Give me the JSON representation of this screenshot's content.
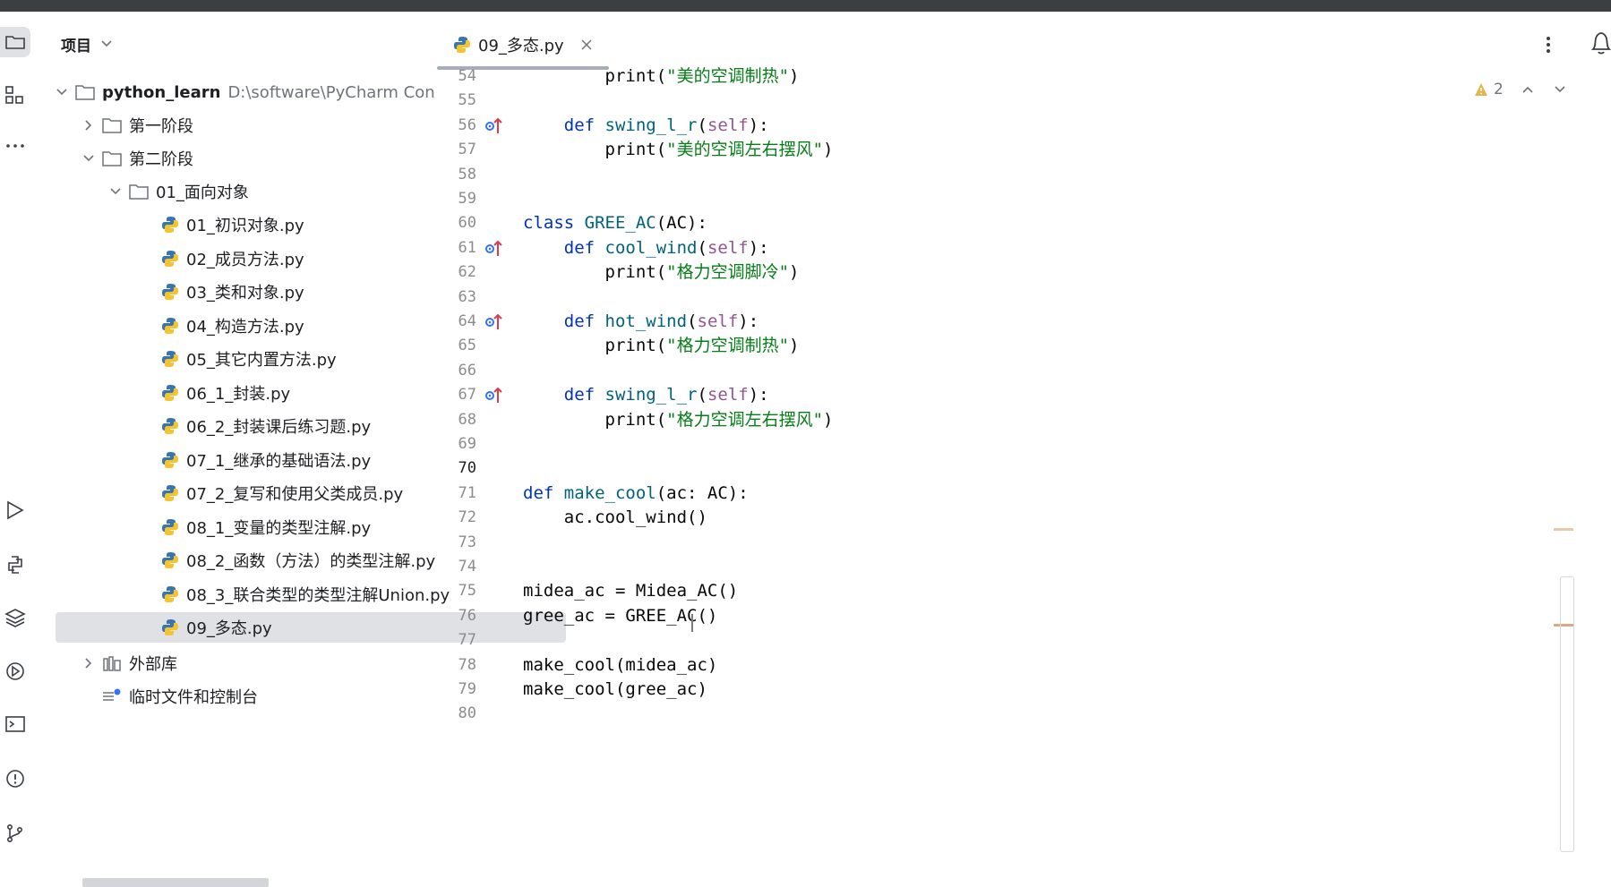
{
  "project_panel": {
    "title": "项目",
    "tree": [
      {
        "label": "python_learn",
        "path": "D:\\software\\PyCharm Con",
        "type": "folder-root",
        "expanded": true
      },
      {
        "label": "第一阶段",
        "type": "folder",
        "expanded": false
      },
      {
        "label": "第二阶段",
        "type": "folder",
        "expanded": true
      },
      {
        "label": "01_面向对象",
        "type": "folder",
        "expanded": true
      },
      {
        "label": "01_初识对象.py",
        "type": "python-file"
      },
      {
        "label": "02_成员方法.py",
        "type": "python-file"
      },
      {
        "label": "03_类和对象.py",
        "type": "python-file"
      },
      {
        "label": "04_构造方法.py",
        "type": "python-file"
      },
      {
        "label": "05_其它内置方法.py",
        "type": "python-file"
      },
      {
        "label": "06_1_封装.py",
        "type": "python-file"
      },
      {
        "label": "06_2_封装课后练习题.py",
        "type": "python-file"
      },
      {
        "label": "07_1_继承的基础语法.py",
        "type": "python-file"
      },
      {
        "label": "07_2_复写和使用父类成员.py",
        "type": "python-file"
      },
      {
        "label": "08_1_变量的类型注解.py",
        "type": "python-file"
      },
      {
        "label": "08_2_函数（方法）的类型注解.py",
        "type": "python-file"
      },
      {
        "label": "08_3_联合类型的类型注解Union.py",
        "type": "python-file"
      },
      {
        "label": "09_多态.py",
        "type": "python-file",
        "selected": true
      },
      {
        "label": "外部库",
        "type": "library",
        "expanded": false
      },
      {
        "label": "临时文件和控制台",
        "type": "scratches"
      }
    ]
  },
  "editor": {
    "active_tab": "09_多态.py",
    "inspection_count": "2",
    "current_line": "70",
    "line_numbers": [
      "54",
      "55",
      "56",
      "57",
      "58",
      "59",
      "60",
      "61",
      "62",
      "63",
      "64",
      "65",
      "66",
      "67",
      "68",
      "69",
      "70",
      "71",
      "72",
      "73",
      "74",
      "75",
      "76",
      "77",
      "78",
      "79",
      "80"
    ],
    "override_marker_lines": [
      "56",
      "61",
      "64",
      "67"
    ],
    "code_lines": [
      "        print(\"美的空调制热\")",
      "",
      "    def swing_l_r(self):",
      "        print(\"美的空调左右摆风\")",
      "",
      "",
      "class GREE_AC(AC):",
      "    def cool_wind(self):",
      "        print(\"格力空调脚冷\")",
      "",
      "    def hot_wind(self):",
      "        print(\"格力空调制热\")",
      "",
      "    def swing_l_r(self):",
      "        print(\"格力空调左右摆风\")",
      "",
      "",
      "def make_cool(ac: AC):",
      "    ac.cool_wind()",
      "",
      "",
      "midea_ac = Midea_AC()",
      "gree_ac = GREE_AC()",
      "",
      "make_cool(midea_ac)",
      "make_cool(gree_ac)",
      ""
    ]
  },
  "activity_bar": {
    "top_icons": [
      "folder-icon",
      "structure-icon",
      "more-icon"
    ],
    "bottom_icons": [
      "run-icon",
      "python-console-icon",
      "layers-icon",
      "services-icon",
      "terminal-icon",
      "problems-icon",
      "git-icon"
    ]
  },
  "colors": {
    "keyword": "#0033b3",
    "function": "#00627a",
    "self": "#94558d",
    "string": "#067d17",
    "selection": "#dfe1e5"
  }
}
